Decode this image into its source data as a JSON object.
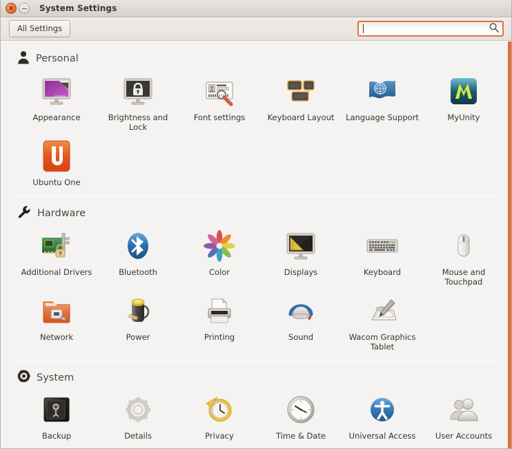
{
  "window": {
    "title": "System Settings",
    "close_label": "x",
    "minimize_label": "",
    "close_icon": "close-icon",
    "minimize_icon": "minimize-icon"
  },
  "toolbar": {
    "all_settings_label": "All Settings",
    "search": {
      "value": "",
      "placeholder": "",
      "icon": "search-icon"
    }
  },
  "accent_color": "#e2703a",
  "sections": [
    {
      "id": "personal",
      "title": "Personal",
      "icon": "person-icon",
      "items": [
        {
          "label": "Appearance",
          "icon": "appearance-icon"
        },
        {
          "label": "Brightness and Lock",
          "icon": "brightness-lock-icon"
        },
        {
          "label": "Font settings",
          "icon": "font-settings-icon"
        },
        {
          "label": "Keyboard Layout",
          "icon": "keyboard-layout-icon"
        },
        {
          "label": "Language Support",
          "icon": "language-support-icon"
        },
        {
          "label": "MyUnity",
          "icon": "myunity-icon"
        },
        {
          "label": "Ubuntu One",
          "icon": "ubuntu-one-icon"
        }
      ]
    },
    {
      "id": "hardware",
      "title": "Hardware",
      "icon": "wrench-icon",
      "items": [
        {
          "label": "Additional Drivers",
          "icon": "additional-drivers-icon"
        },
        {
          "label": "Bluetooth",
          "icon": "bluetooth-icon"
        },
        {
          "label": "Color",
          "icon": "color-icon"
        },
        {
          "label": "Displays",
          "icon": "displays-icon"
        },
        {
          "label": "Keyboard",
          "icon": "keyboard-icon"
        },
        {
          "label": "Mouse and Touchpad",
          "icon": "mouse-touchpad-icon"
        },
        {
          "label": "Network",
          "icon": "network-icon"
        },
        {
          "label": "Power",
          "icon": "power-icon"
        },
        {
          "label": "Printing",
          "icon": "printing-icon"
        },
        {
          "label": "Sound",
          "icon": "sound-icon"
        },
        {
          "label": "Wacom Graphics Tablet",
          "icon": "wacom-tablet-icon"
        }
      ]
    },
    {
      "id": "system",
      "title": "System",
      "icon": "ubuntu-logo-icon",
      "items": [
        {
          "label": "Backup",
          "icon": "backup-icon"
        },
        {
          "label": "Details",
          "icon": "details-icon"
        },
        {
          "label": "Privacy",
          "icon": "privacy-icon"
        },
        {
          "label": "Time & Date",
          "icon": "time-date-icon"
        },
        {
          "label": "Universal Access",
          "icon": "universal-access-icon"
        },
        {
          "label": "User Accounts",
          "icon": "user-accounts-icon"
        }
      ]
    }
  ]
}
